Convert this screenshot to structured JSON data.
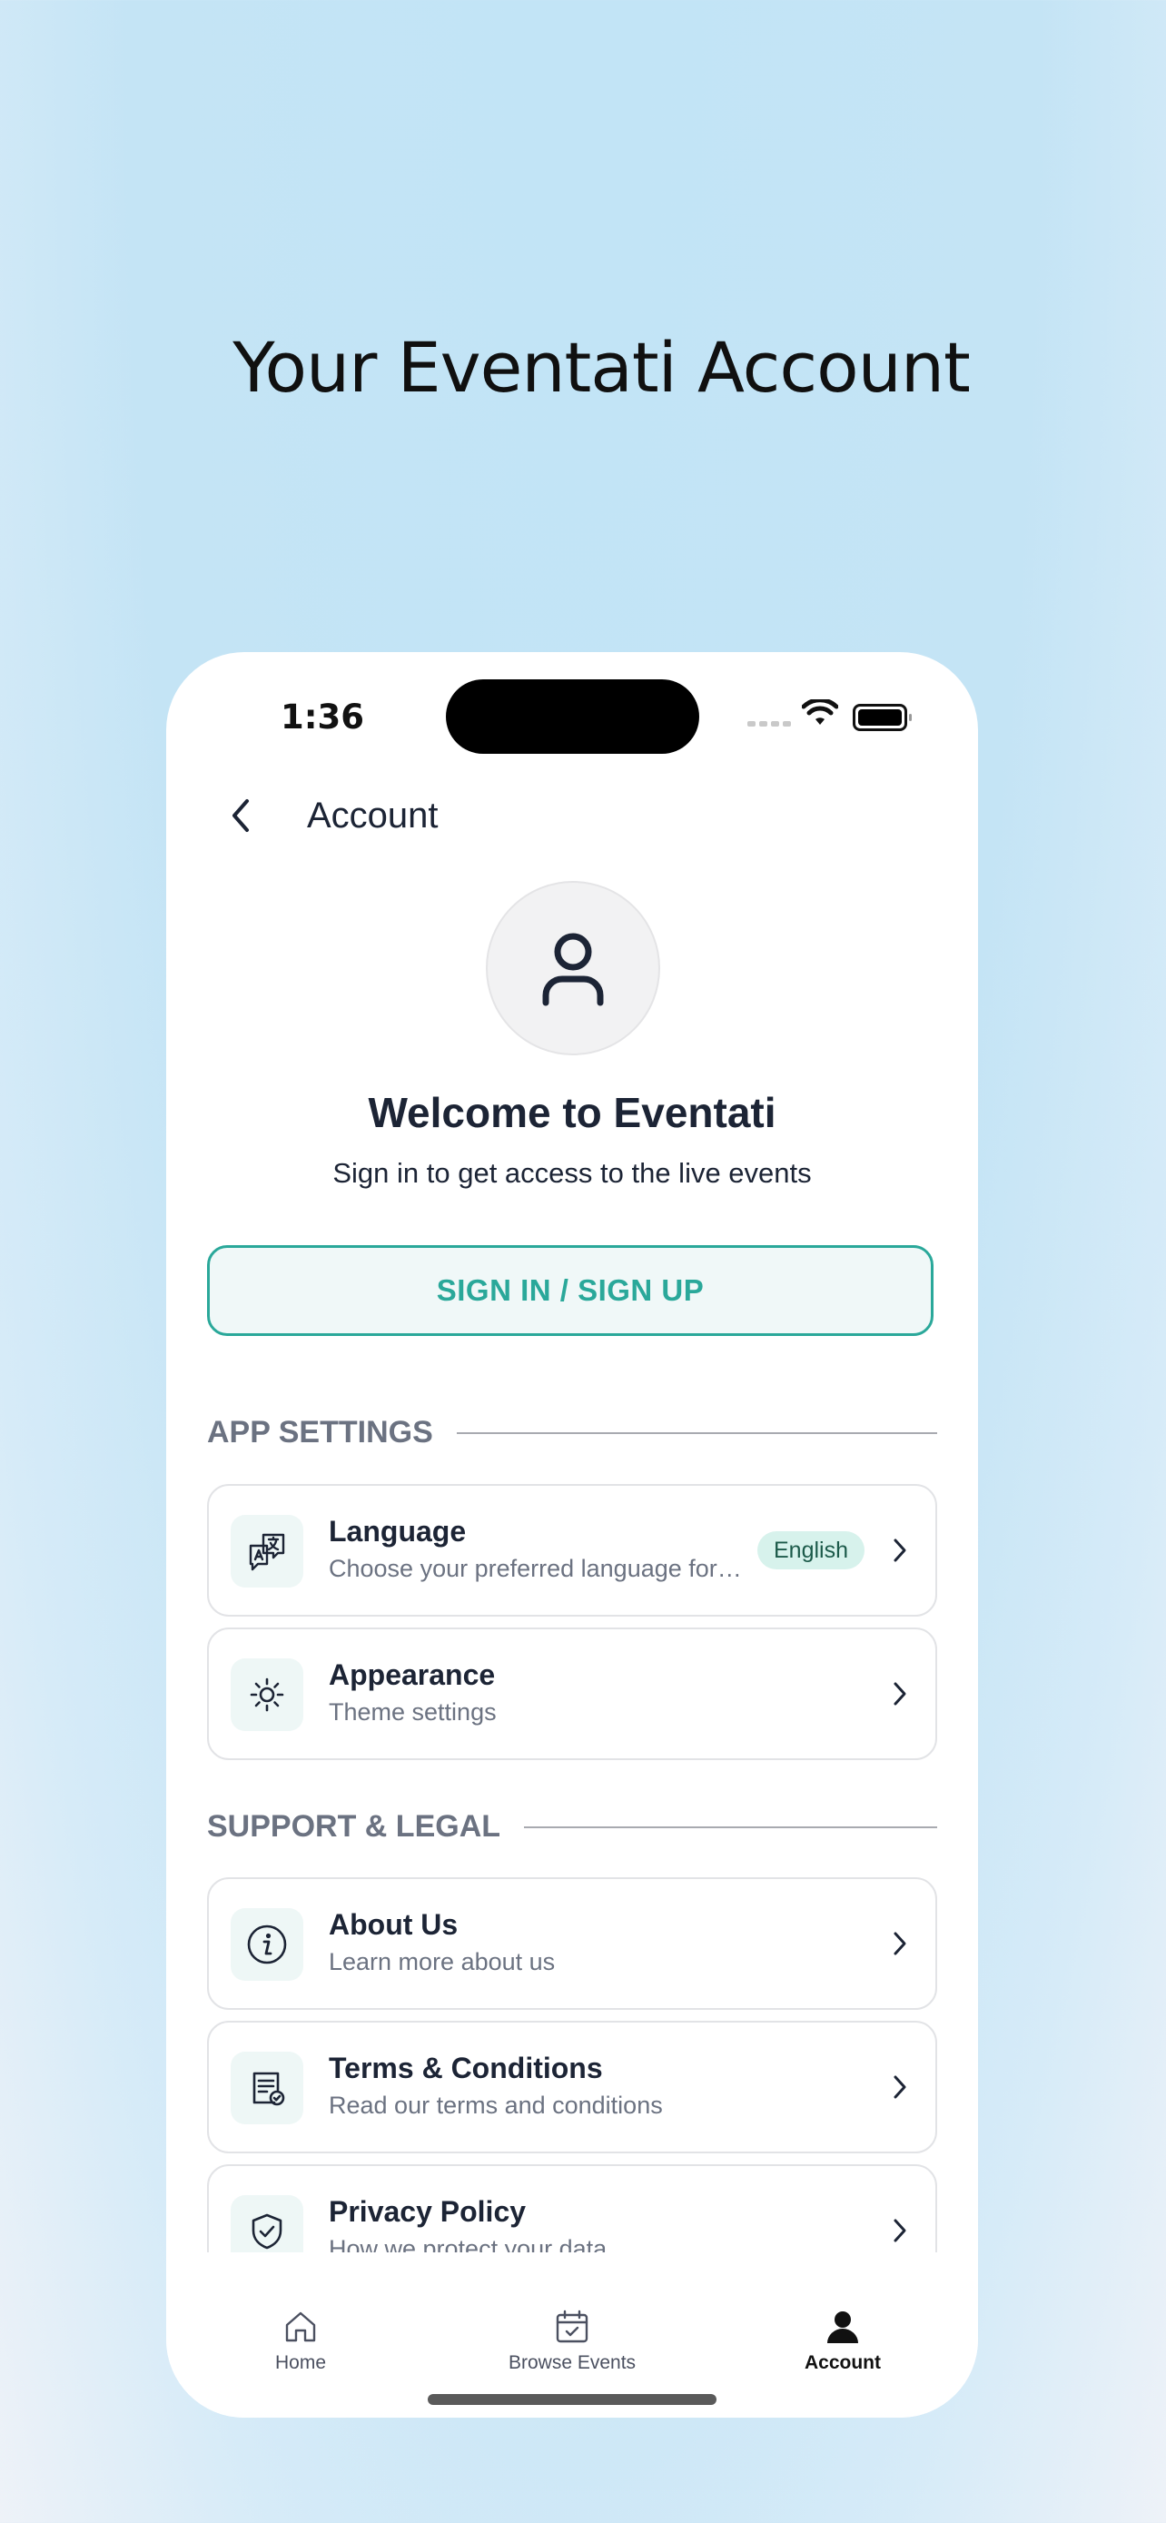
{
  "headline": "Your Eventati Account",
  "status": {
    "time": "1:36"
  },
  "nav": {
    "title": "Account",
    "back_icon": "chevron-left-icon"
  },
  "profile": {
    "avatar_icon": "user-icon",
    "welcome": "Welcome to Eventati",
    "subtitle": "Sign in to get access to the live events",
    "signin_label": "SIGN IN / SIGN UP"
  },
  "sections": {
    "app_settings": "APP SETTINGS",
    "support_legal": "SUPPORT & LEGAL"
  },
  "items": {
    "language": {
      "title": "Language",
      "desc": "Choose your preferred language for the app",
      "badge": "English",
      "icon": "translate-icon"
    },
    "appearance": {
      "title": "Appearance",
      "desc": "Theme settings",
      "icon": "sun-icon"
    },
    "about": {
      "title": "About Us",
      "desc": "Learn more about us",
      "icon": "info-icon"
    },
    "terms": {
      "title": "Terms & Conditions",
      "desc": "Read our terms and conditions",
      "icon": "document-check-icon"
    },
    "privacy": {
      "title": "Privacy Policy",
      "desc": "How we protect your data",
      "icon": "shield-check-icon"
    }
  },
  "tabs": [
    {
      "label": "Home",
      "icon": "home-icon"
    },
    {
      "label": "Browse Events",
      "icon": "calendar-check-icon"
    },
    {
      "label": "Account",
      "icon": "person-icon",
      "active": true
    }
  ],
  "colors": {
    "accent": "#2aa89a",
    "text": "#1c2435",
    "muted": "#6b7281"
  }
}
